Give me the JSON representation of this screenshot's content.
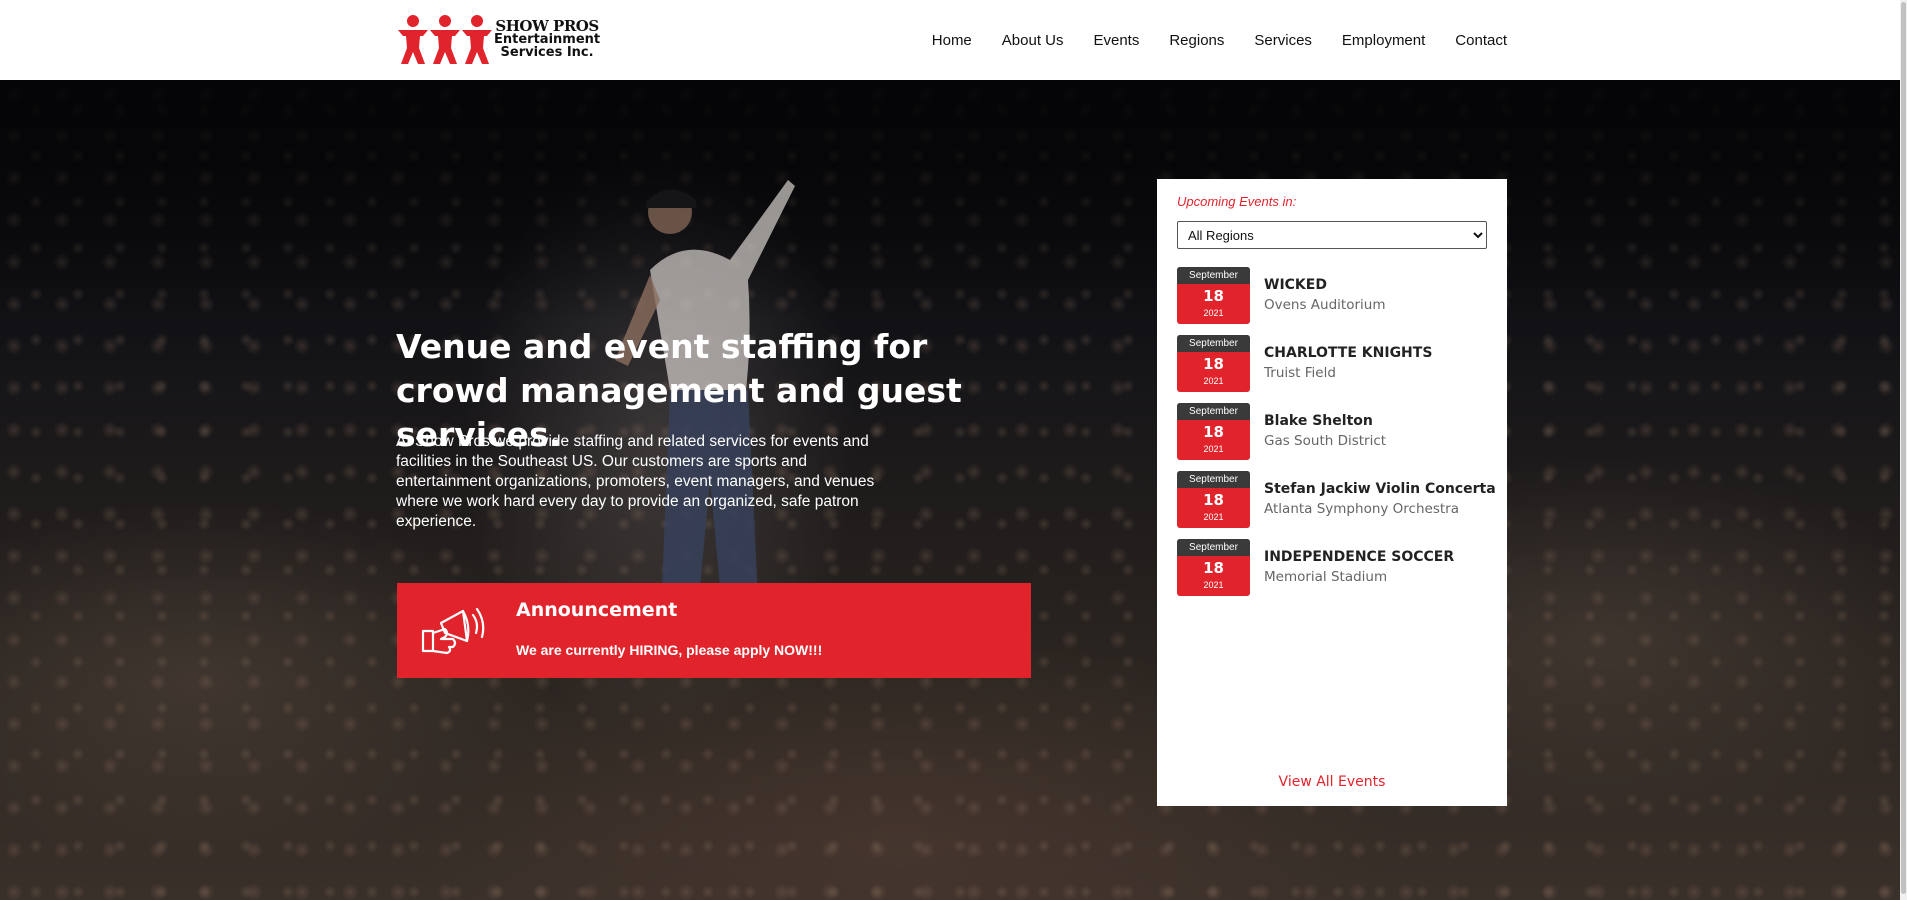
{
  "brand": {
    "line1": "SHOW PROS",
    "line2": "Entertainment",
    "line3": "Services Inc.",
    "color": "#e1232b"
  },
  "nav": {
    "home": "Home",
    "about": "About Us",
    "events": "Events",
    "regions": "Regions",
    "services": "Services",
    "employment": "Employment",
    "contact": "Contact"
  },
  "hero": {
    "title": "Venue and event staffing for crowd management and guest services.",
    "description": "At Show Pros we provide staffing and related services for events and facilities in the Southeast US. Our customers are sports and entertainment organizations, promoters, event managers, and venues where we work hard every day to provide an organized, safe patron experience."
  },
  "announcement": {
    "icon": "megaphone-icon",
    "title": "Announcement",
    "text": "We are currently HIRING, please apply NOW!!!"
  },
  "events": {
    "heading": "Upcoming Events in:",
    "selected_region": "All Regions",
    "items": [
      {
        "month": "September",
        "day": "18",
        "year": "2021",
        "name": "WICKED",
        "venue": "Ovens Auditorium"
      },
      {
        "month": "September",
        "day": "18",
        "year": "2021",
        "name": "CHARLOTTE KNIGHTS",
        "venue": "Truist Field"
      },
      {
        "month": "September",
        "day": "18",
        "year": "2021",
        "name": "Blake Shelton",
        "venue": "Gas South District"
      },
      {
        "month": "September",
        "day": "18",
        "year": "2021",
        "name": "Stefan Jackiw Violin Concerta",
        "venue": "Atlanta Symphony Orchestra"
      },
      {
        "month": "September",
        "day": "18",
        "year": "2021",
        "name": "INDEPENDENCE SOCCER",
        "venue": "Memorial Stadium"
      }
    ],
    "view_all": "View All Events"
  }
}
